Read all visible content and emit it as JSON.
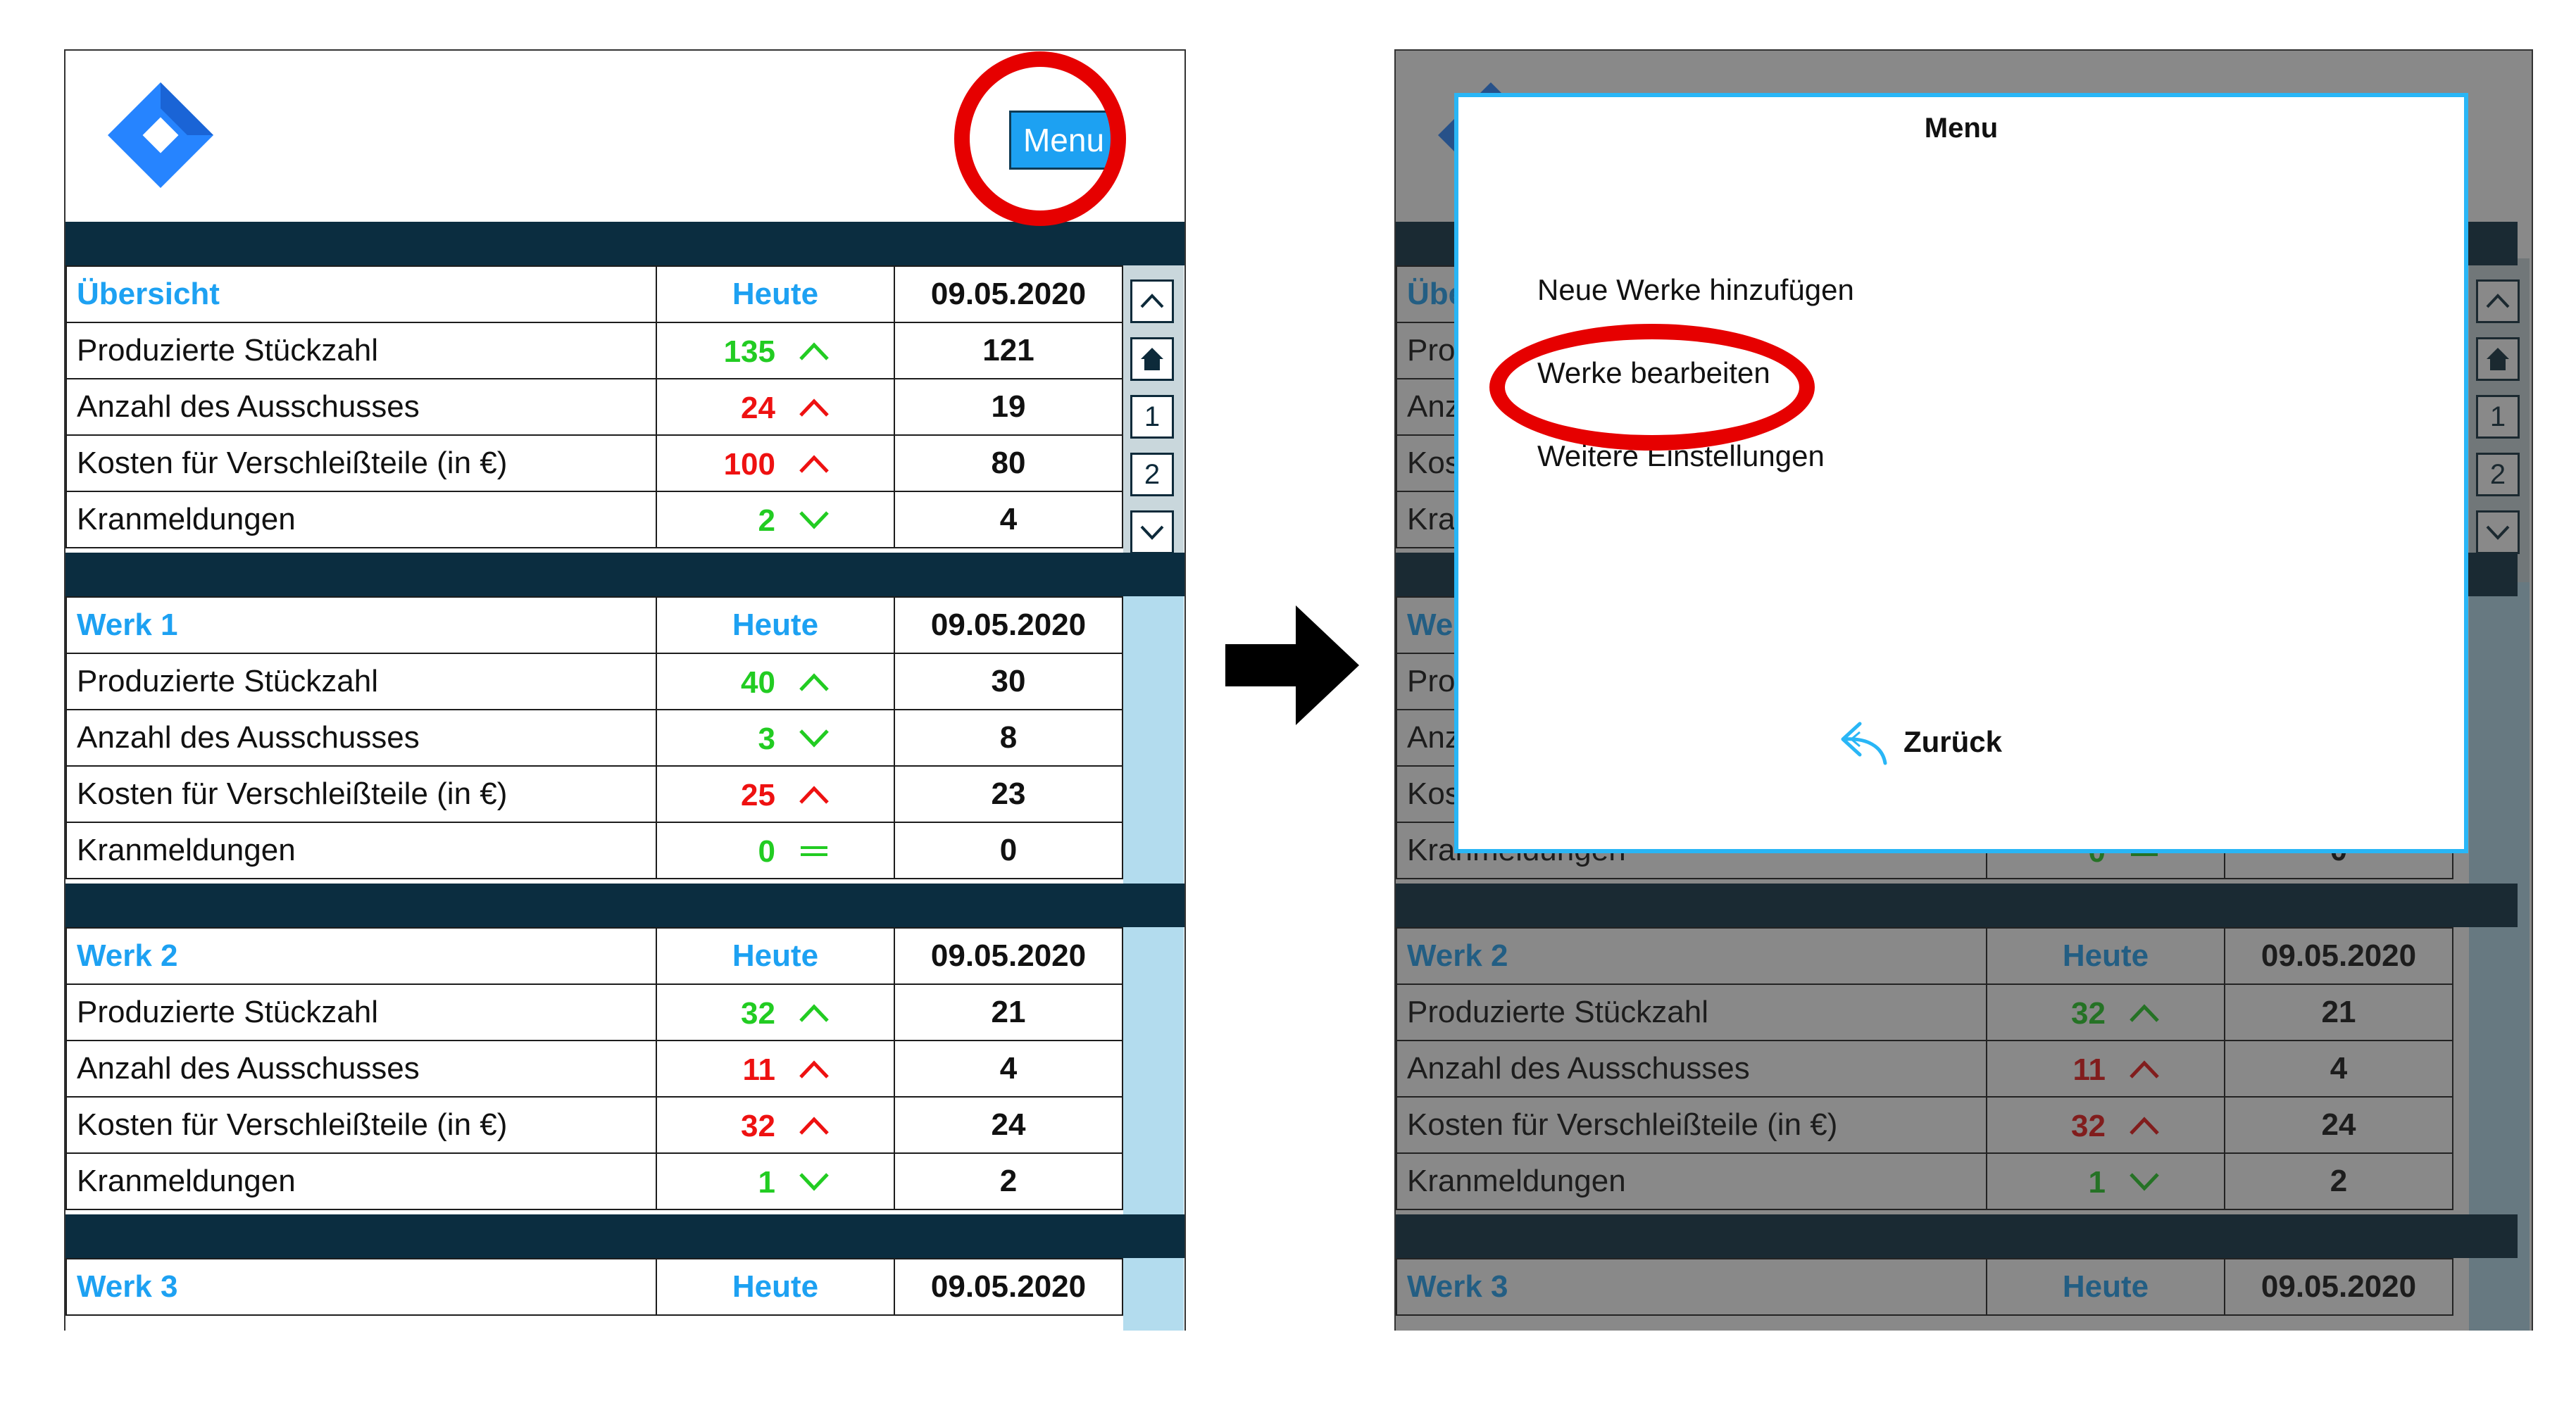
{
  "menu_button": "Menu",
  "header_col": "Heute",
  "date": "09.05.2020",
  "sections": [
    {
      "title": "Übersicht",
      "rows": [
        {
          "label": "Produzierte Stückzahl",
          "today": "135",
          "trend": "up",
          "color": "green",
          "prev": "121"
        },
        {
          "label": "Anzahl des Ausschusses",
          "today": "24",
          "trend": "up",
          "color": "red",
          "prev": "19"
        },
        {
          "label": "Kosten für Verschleißteile (in €)",
          "today": "100",
          "trend": "up",
          "color": "red",
          "prev": "80"
        },
        {
          "label": "Kranmeldungen",
          "today": "2",
          "trend": "down",
          "color": "green",
          "prev": "4"
        }
      ]
    },
    {
      "title": "Werk 1",
      "rows": [
        {
          "label": "Produzierte Stückzahl",
          "today": "40",
          "trend": "up",
          "color": "green",
          "prev": "30"
        },
        {
          "label": "Anzahl des Ausschusses",
          "today": "3",
          "trend": "down",
          "color": "green",
          "prev": "8"
        },
        {
          "label": "Kosten für Verschleißteile (in €)",
          "today": "25",
          "trend": "up",
          "color": "red",
          "prev": "23"
        },
        {
          "label": "Kranmeldungen",
          "today": "0",
          "trend": "equal",
          "color": "green",
          "prev": "0"
        }
      ]
    },
    {
      "title": "Werk 2",
      "rows": [
        {
          "label": "Produzierte Stückzahl",
          "today": "32",
          "trend": "up",
          "color": "green",
          "prev": "21"
        },
        {
          "label": "Anzahl des Ausschusses",
          "today": "11",
          "trend": "up",
          "color": "red",
          "prev": "4"
        },
        {
          "label": "Kosten für Verschleißteile (in €)",
          "today": "32",
          "trend": "up",
          "color": "red",
          "prev": "24"
        },
        {
          "label": "Kranmeldungen",
          "today": "1",
          "trend": "down",
          "color": "green",
          "prev": "2"
        }
      ]
    },
    {
      "title": "Werk 3",
      "rows": []
    }
  ],
  "scroll_buttons": {
    "page1": "1",
    "page2": "2"
  },
  "modal": {
    "title": "Menu",
    "items": [
      "Neue Werke hinzufügen",
      "Werke bearbeiten",
      "Weitere Einstellungen"
    ],
    "back_label": "Zurück"
  },
  "colors": {
    "accent": "#1da1f2",
    "bar": "#0b2d40",
    "green": "#22cc22",
    "red": "#ee1111",
    "highlight_ring": "#e60000"
  }
}
